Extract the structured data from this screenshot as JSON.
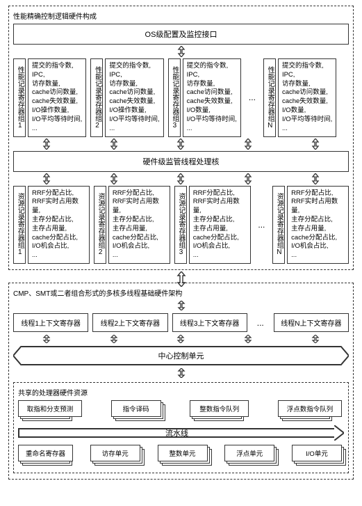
{
  "sections": {
    "perf_ctrl_title": "性能精确控制逻辑硬件构成",
    "os_interface": "OS级配置及监控接口",
    "perf_group_label_prefix": "性能记录寄存器组",
    "perf_groups": [
      "1",
      "2",
      "3",
      "N"
    ],
    "perf_metrics": [
      "提交的指令数,",
      "IPC,",
      "访存数量,",
      "cache访问数量,",
      "cache失效数量,",
      "I/O操作数量,",
      "I/O平均等待时间,",
      "..."
    ],
    "perf_metrics_alt": [
      "提交的指令数,",
      "IPC,",
      "访存数量,",
      "cache访问数量,",
      "cache失效数量,",
      "I/O数量,",
      "I/O平均等待时间,",
      "..."
    ],
    "hw_monitor": "硬件级监管线程处理核",
    "res_group_label_prefix": "资源记录寄存器组",
    "res_groups": [
      "1",
      "2",
      "3",
      "N"
    ],
    "res_metrics": [
      "RRF分配占比,",
      "RRF实时占用数量,",
      "主存分配占比,",
      "主存占用量,",
      "cache分配占比,",
      "I/O机会占比,",
      "..."
    ],
    "arch_title": "CMP、SMT或二者组合形式的多核多线程基础硬件架构",
    "ctx_prefix": "线程",
    "ctx_suffix": "上下文寄存器",
    "ctx_ids": [
      "1",
      "2",
      "3",
      "N"
    ],
    "central_ctrl": "中心控制单元",
    "shared_title": "共享的处理器硬件资源",
    "shared_top": [
      "取指和分支预测",
      "指令译码",
      "整数指令队列",
      "浮点数指令队列"
    ],
    "pipeline": "流水线",
    "shared_bottom": [
      "重命名寄存器",
      "访存单元",
      "整数单元",
      "浮点单元",
      "I/O单元"
    ],
    "ellipsis": "..."
  }
}
